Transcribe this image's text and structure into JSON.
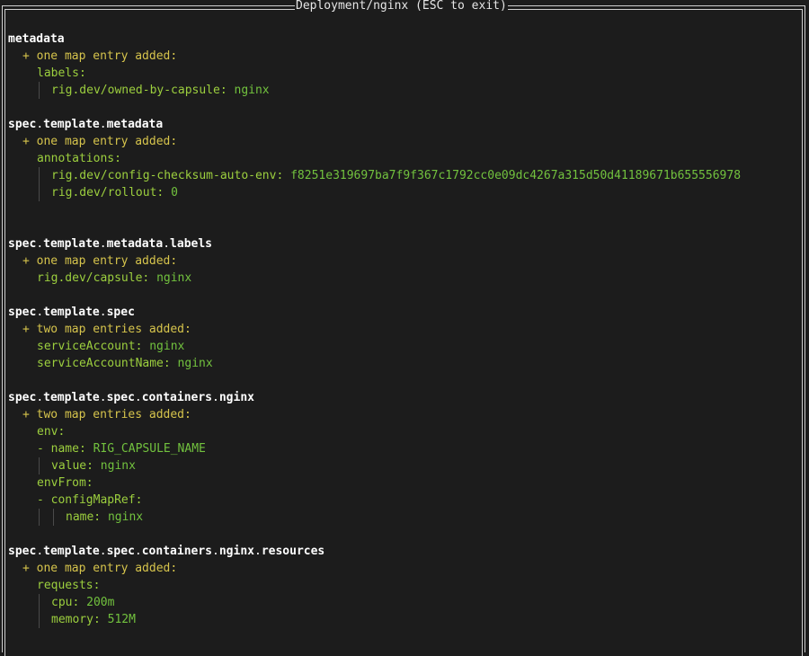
{
  "window": {
    "title": "Deployment/nginx (ESC to exit)"
  },
  "sections": [
    {
      "path": [
        "metadata"
      ],
      "change": "+ one map entry added:",
      "lines": [
        {
          "key": "labels:",
          "value": ""
        },
        {
          "key": "rig.dev/owned-by-capsule:",
          "value": "nginx"
        }
      ]
    },
    {
      "path": [
        "spec",
        "template",
        "metadata"
      ],
      "change": "+ one map entry added:",
      "lines": [
        {
          "key": "annotations:",
          "value": ""
        },
        {
          "key": "rig.dev/config-checksum-auto-env:",
          "value": "f8251e319697ba7f9f367c1792cc0e09dc4267a315d50d41189671b655556978"
        },
        {
          "key": "rig.dev/rollout:",
          "value": "0"
        }
      ]
    },
    {
      "path": [
        "spec",
        "template",
        "metadata",
        "labels"
      ],
      "change": "+ one map entry added:",
      "lines": [
        {
          "key": "rig.dev/capsule:",
          "value": "nginx"
        }
      ]
    },
    {
      "path": [
        "spec",
        "template",
        "spec"
      ],
      "change": "+ two map entries added:",
      "lines": [
        {
          "key": "serviceAccount:",
          "value": "nginx"
        },
        {
          "key": "serviceAccountName:",
          "value": "nginx"
        }
      ]
    },
    {
      "path": [
        "spec",
        "template",
        "spec",
        "containers",
        "nginx"
      ],
      "change": "+ two map entries added:",
      "lines": [
        {
          "key": "env:",
          "value": ""
        },
        {
          "key": "- name:",
          "value": "RIG_CAPSULE_NAME"
        },
        {
          "key": "value:",
          "value": "nginx"
        },
        {
          "key": "envFrom:",
          "value": ""
        },
        {
          "key": "- configMapRef:",
          "value": ""
        },
        {
          "key": "name:",
          "value": "nginx"
        }
      ]
    },
    {
      "path": [
        "spec",
        "template",
        "spec",
        "containers",
        "nginx",
        "resources"
      ],
      "change": "+ one map entry added:",
      "lines": [
        {
          "key": "requests:",
          "value": ""
        },
        {
          "key": "cpu:",
          "value": "200m"
        },
        {
          "key": "memory:",
          "value": "512M"
        }
      ]
    }
  ],
  "separator": "."
}
